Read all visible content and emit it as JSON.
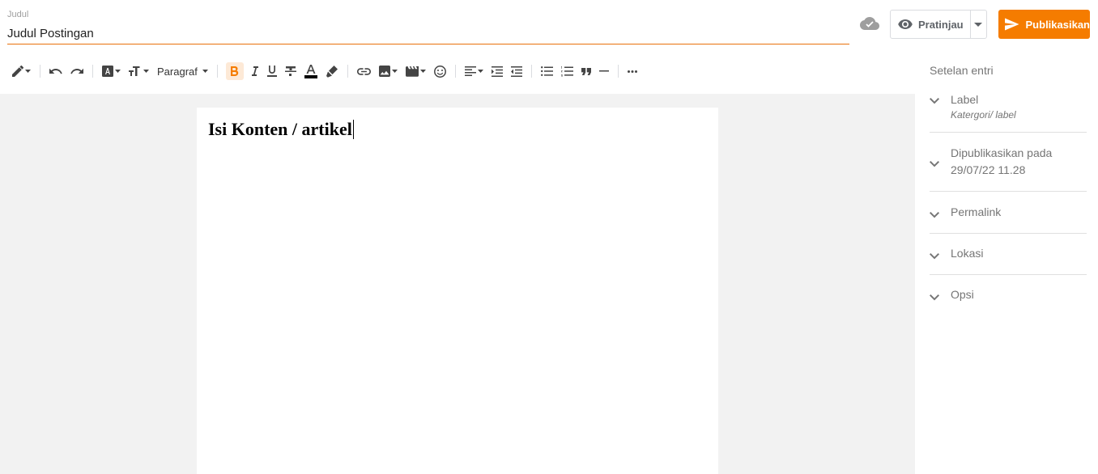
{
  "header": {
    "title_label": "Judul",
    "title_value": "Judul Postingan",
    "preview_label": "Pratinjau",
    "publish_label": "Publikasikan"
  },
  "toolbar": {
    "paragraph_label": "Paragraf",
    "buttons": [
      "pencil-icon",
      "undo-icon",
      "redo-icon",
      "font-family-icon",
      "font-size-icon",
      "bold-icon",
      "italic-icon",
      "underline-icon",
      "strikethrough-icon",
      "text-color-icon",
      "highlight-icon",
      "link-icon",
      "image-icon",
      "video-icon",
      "emoji-icon",
      "align-icon",
      "indent-icon",
      "outdent-icon",
      "bulleted-list-icon",
      "numbered-list-icon",
      "quote-icon",
      "horizontal-rule-icon",
      "more-icon"
    ],
    "colors": {
      "accent": "#f57c00",
      "text_color_bar": "#000000",
      "bold_active_bg": "#fde9d6"
    }
  },
  "editor": {
    "content_heading": "Isi Konten / artikel"
  },
  "sidebar": {
    "title": "Setelan entri",
    "items": [
      {
        "label": "Label",
        "sub": "Katergori/ label"
      },
      {
        "label": "Dipublikasikan pada",
        "sub": "29/07/22 11.28"
      },
      {
        "label": "Permalink"
      },
      {
        "label": "Lokasi"
      },
      {
        "label": "Opsi"
      }
    ]
  }
}
